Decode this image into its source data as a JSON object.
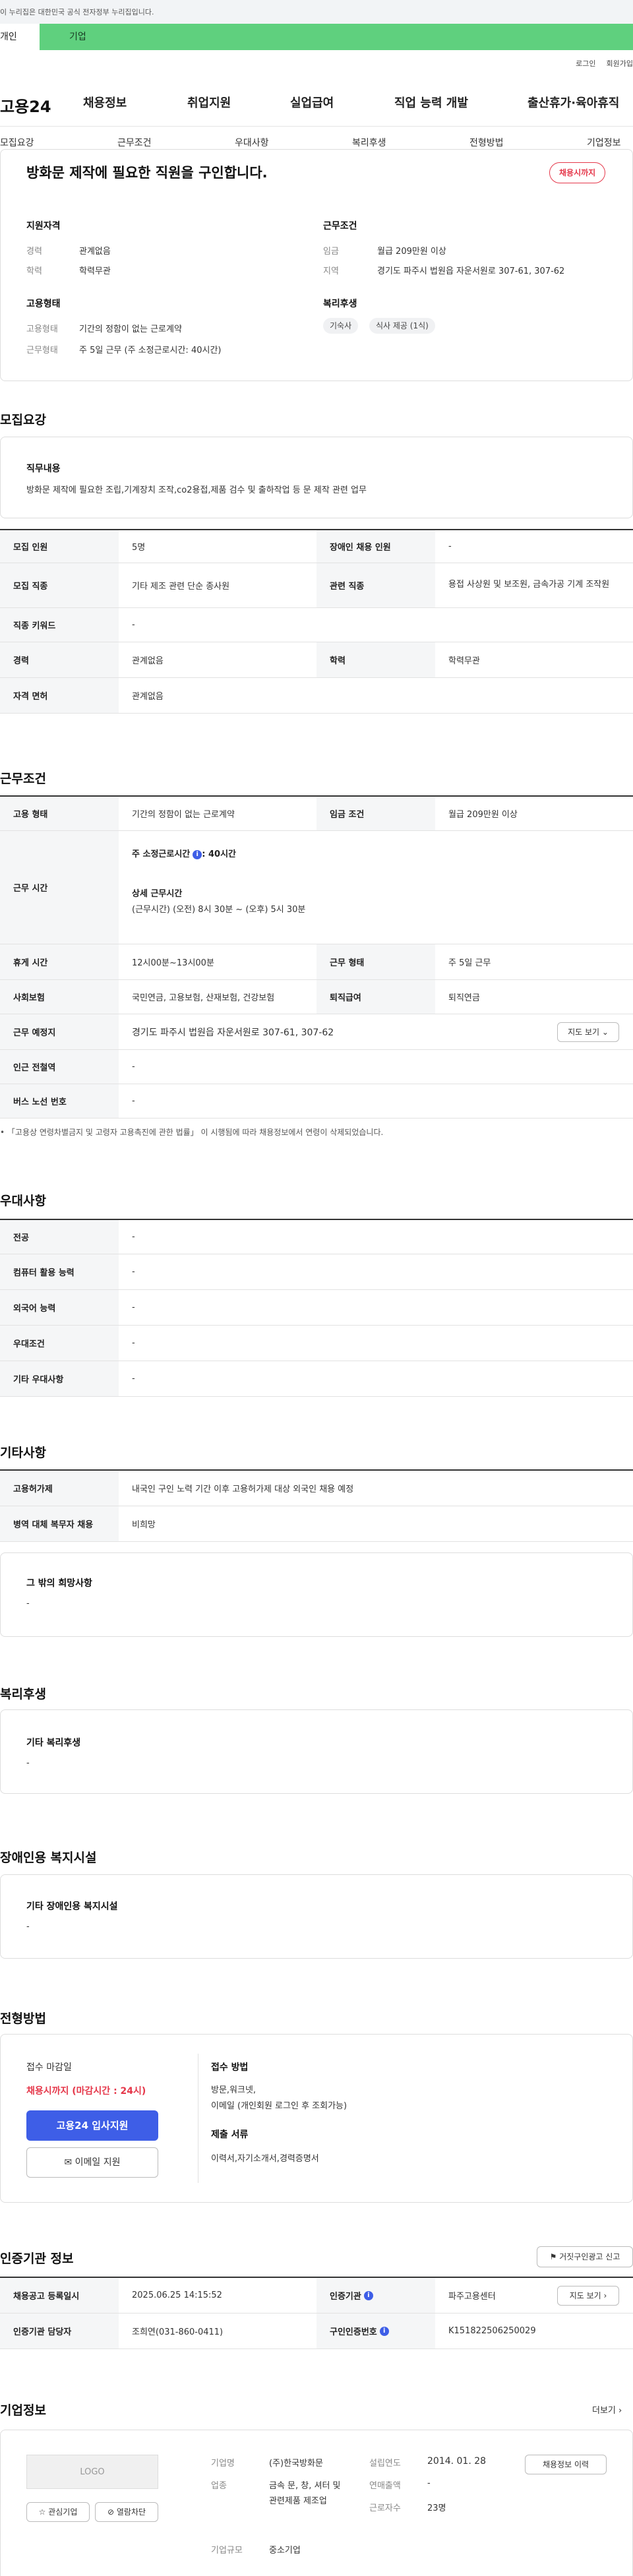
{
  "gov_banner": "이 누리집은 대한민국 공식 전자정부 누리집입니다.",
  "user_tabs": {
    "personal": "개인",
    "corporate": "기업"
  },
  "util_links": {
    "login": "로그인",
    "join": "회원가입"
  },
  "logo": "고용24",
  "gnb": [
    "채용정보",
    "취업지원",
    "실업급여",
    "직업 능력 개발",
    "출산휴가·육아휴직"
  ],
  "section_tabs": [
    "모집요강",
    "근무조건",
    "우대사항",
    "복리후생",
    "전형방법",
    "기업정보"
  ],
  "summary": {
    "title": "방화문 제작에 필요한 직원을 구인합니다.",
    "status_badge": "채용시까지",
    "qual_head": "지원자격",
    "career_label": "경력",
    "career_value": "관계없음",
    "edu_label": "학력",
    "edu_value": "학력무관",
    "emp_head": "고용형태",
    "emp_label": "고용형태",
    "emp_value": "기간의 정함이 없는 근로계약",
    "work_label": "근무형태",
    "work_value": "주 5일 근무 (주 소정근로시간: 40시간)",
    "cond_head": "근무조건",
    "wage_label": "임금",
    "wage_value": "월급 209만원 이상",
    "area_label": "지역",
    "area_value": "경기도 파주시 법원읍 자운서원로 307-61, 307-62",
    "welfare_head": "복리후생",
    "welfare_chips": [
      "기숙사",
      "식사 제공 (1식)"
    ]
  },
  "recruit": {
    "heading": "모집요강",
    "duty_head": "직무내용",
    "duty_text": "방화문 제작에 필요한 조립,기계장치 조작,co2용접,제품 검수 및 출하작업 등 문 제작 관련 업무",
    "rows": [
      [
        "모집 인원",
        "5명",
        "장애인 채용 인원",
        "-"
      ],
      [
        "모집 직종",
        "기타 제조 관련 단순 종사원",
        "관련 직종",
        "용접 사상원 및 보조원, 금속가공 기계 조작원"
      ],
      [
        "직종 키워드",
        "-"
      ],
      [
        "경력",
        "관계없음",
        "학력",
        "학력무관"
      ],
      [
        "자격 면허",
        "관계없음"
      ]
    ]
  },
  "work": {
    "heading": "근무조건",
    "r1": [
      "고용 형태",
      "기간의 정함이 없는 근로계약",
      "임금 조건",
      "월급 209만원 이상"
    ],
    "hours_label": "근무 시간",
    "hours_main": "주 소정근로시간",
    "hours_main_val": ": 40시간",
    "hours_detail_head": "상세 근무시간",
    "hours_detail": "(근무시간) (오전) 8시 30분 ~ (오후) 5시 30분",
    "r3": [
      "휴게 시간",
      "12시00분~13시00분",
      "근무 형태",
      "주 5일 근무"
    ],
    "r4": [
      "사회보험",
      "국민연금, 고용보험, 산재보험, 건강보험",
      "퇴직급여",
      "퇴직연금"
    ],
    "r5": [
      "근무 예정지",
      "경기도 파주시 법원읍 자운서원로 307-61, 307-62"
    ],
    "map_btn": "지도 보기",
    "r6": [
      "인근 전철역",
      "-"
    ],
    "r7": [
      "버스 노선 번호",
      "-"
    ],
    "note": "「고용상 연령차별금지 및 고령자 고용촉진에 관한 법률」 이 시행됨에 따라 채용정보에서 연령이 삭제되었습니다."
  },
  "pref": {
    "heading": "우대사항",
    "rows": [
      [
        "전공",
        "-"
      ],
      [
        "컴퓨터 활용 능력",
        "-"
      ],
      [
        "외국어 능력",
        "-"
      ],
      [
        "우대조건",
        "-"
      ],
      [
        "기타 우대사항",
        "-"
      ]
    ]
  },
  "etc": {
    "heading": "기타사항",
    "rows": [
      [
        "고용허가제",
        "내국인 구인 노력 기간 이후 고용허가제 대상 외국인 채용 예정"
      ],
      [
        "병역 대체 복무자 채용",
        "비희망"
      ]
    ],
    "other_head": "그 밖의 희망사항",
    "other_val": "-"
  },
  "welfare": {
    "heading": "복리후생",
    "box_head": "기타 복리후생",
    "box_val": "-"
  },
  "disabled": {
    "heading": "장애인용 복지시설",
    "box_head": "기타 장애인용 복지시설",
    "box_val": "-"
  },
  "screening": {
    "heading": "전형방법",
    "deadline_head": "접수 마감일",
    "deadline_val": "채용시까지 (마감시간 : 24시)",
    "apply_btn": "고용24 입사지원",
    "email_btn": "이메일 지원",
    "method_head": "접수 방법",
    "method_val1": "방문,워크넷,",
    "method_val2": "이메일 (개인회원 로그인 후 조회가능)",
    "docs_head": "제출 서류",
    "docs_val": "이력서,자기소개서,경력증명서"
  },
  "agency": {
    "heading": "인증기관 정보",
    "report_btn": "거짓구인광고 신고",
    "r1": [
      "채용공고 등록일시",
      "2025.06.25 14:15:52",
      "인증기관",
      "파주고용센터"
    ],
    "map_btn": "지도 보기",
    "r2": [
      "인증기관 담당자",
      "조희연(031-860-0411)",
      "구인인증번호",
      "K151822506250029"
    ]
  },
  "company": {
    "heading": "기업정보",
    "more": "더보기",
    "logo_text": "LOGO",
    "interest_btn": "관심기업",
    "block_btn": "열람차단",
    "name_label": "기업명",
    "name_val": "(주)한국방화문",
    "biz_label": "업종",
    "biz_val": "금속 문, 창, 셔터 및 관련제품 제조업",
    "size_label": "기업규모",
    "size_val": "중소기업",
    "year_label": "설립연도",
    "year_val": "2014. 01. 28",
    "sales_label": "연매출액",
    "sales_val": "-",
    "emp_label": "근로자수",
    "emp_val": "23명",
    "history_btn": "채용정보 이력"
  }
}
